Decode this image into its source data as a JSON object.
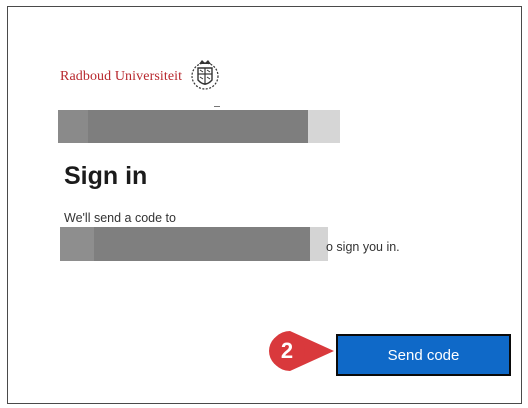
{
  "branding": {
    "university_name": "Radboud Universiteit",
    "seal_icon": "radboud-seal-icon",
    "brand_color": "#b8282e"
  },
  "signin": {
    "title": "Sign in",
    "message_line_1": "We'll send a code to",
    "message_line_2_suffix": "o sign you in."
  },
  "actions": {
    "send_code_label": "Send code",
    "button_color": "#0f69c8"
  },
  "annotation": {
    "step_number": "2",
    "marker_color": "#d9393c"
  }
}
